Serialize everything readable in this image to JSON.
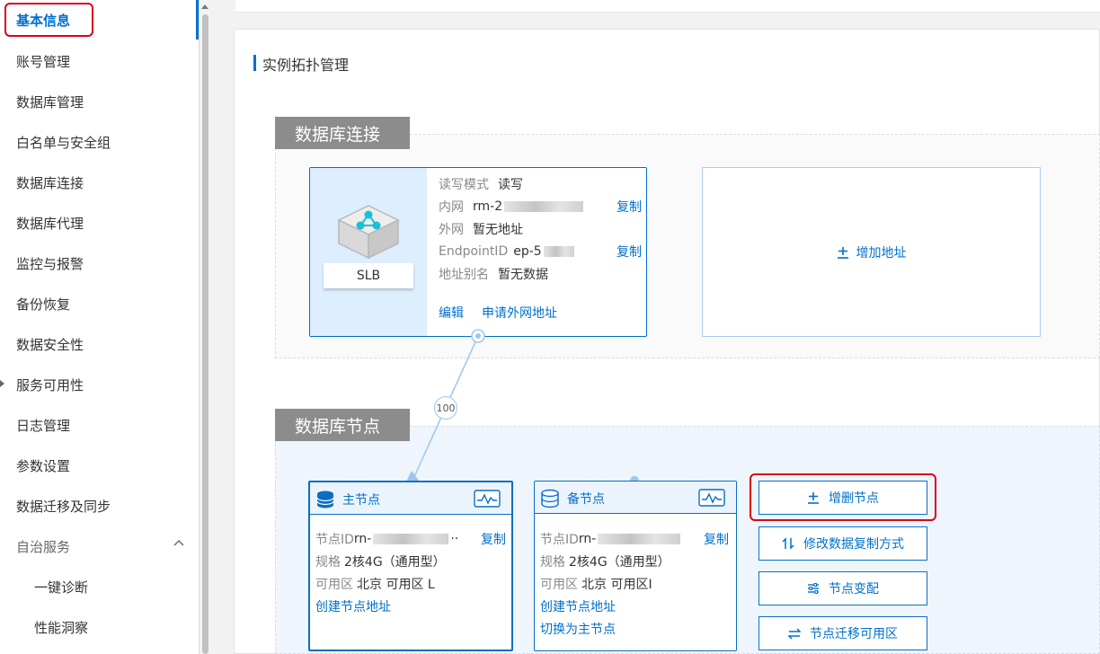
{
  "sidebar": {
    "items": [
      {
        "label": "基本信息",
        "active": true
      },
      {
        "label": "账号管理"
      },
      {
        "label": "数据库管理"
      },
      {
        "label": "白名单与安全组"
      },
      {
        "label": "数据库连接"
      },
      {
        "label": "数据库代理"
      },
      {
        "label": "监控与报警"
      },
      {
        "label": "备份恢复"
      },
      {
        "label": "数据安全性"
      },
      {
        "label": "服务可用性"
      },
      {
        "label": "日志管理"
      },
      {
        "label": "参数设置"
      },
      {
        "label": "数据迁移及同步"
      },
      {
        "label": "自治服务",
        "expanded": true
      },
      {
        "label": "一键诊断",
        "sub": true
      },
      {
        "label": "性能洞察",
        "sub": true
      }
    ]
  },
  "page": {
    "title": "实例拓扑管理"
  },
  "connection_section": {
    "label": "数据库连接",
    "slb": {
      "label": "SLB",
      "rows": {
        "rw_mode_key": "读写模式",
        "rw_mode_val": "读写",
        "intranet_key": "内网",
        "intranet_val": "rm-2",
        "internet_key": "外网",
        "internet_val": "暂无地址",
        "endpoint_key": "EndpointID",
        "endpoint_val": "ep-5",
        "alias_key": "地址别名",
        "alias_val": "暂无数据"
      },
      "copy_label": "复制",
      "edit_label": "编辑",
      "apply_public_label": "申请外网地址"
    },
    "add_address_label": "增加地址"
  },
  "weight_badge": "100",
  "nodes_section": {
    "label": "数据库节点",
    "primary": {
      "title": "主节点",
      "id_key": "节点ID",
      "id_val": "rn-",
      "id_suffix": "··",
      "spec_key": "规格",
      "spec_val": "2核4G（通用型）",
      "zone_key": "可用区",
      "zone_val": "北京 可用区 L",
      "copy_label": "复制",
      "create_addr_label": "创建节点地址"
    },
    "standby": {
      "title": "备节点",
      "id_key": "节点ID",
      "id_val": "rn-",
      "spec_key": "规格",
      "spec_val": "2核4G（通用型）",
      "zone_key": "可用区",
      "zone_val": "北京 可用区I",
      "copy_label": "复制",
      "create_addr_label": "创建节点地址",
      "switch_label": "切换为主节点"
    },
    "actions": [
      {
        "label": "增删节点",
        "icon": "plus-minus-icon"
      },
      {
        "label": "修改数据复制方式",
        "icon": "sort-arrows-icon"
      },
      {
        "label": "节点变配",
        "icon": "sliders-icon"
      },
      {
        "label": "节点迁移可用区",
        "icon": "swap-arrows-icon"
      }
    ]
  },
  "colors": {
    "accent": "#0070cc",
    "highlight": "#d9001b",
    "section_label_bg": "#8c8c8c"
  }
}
